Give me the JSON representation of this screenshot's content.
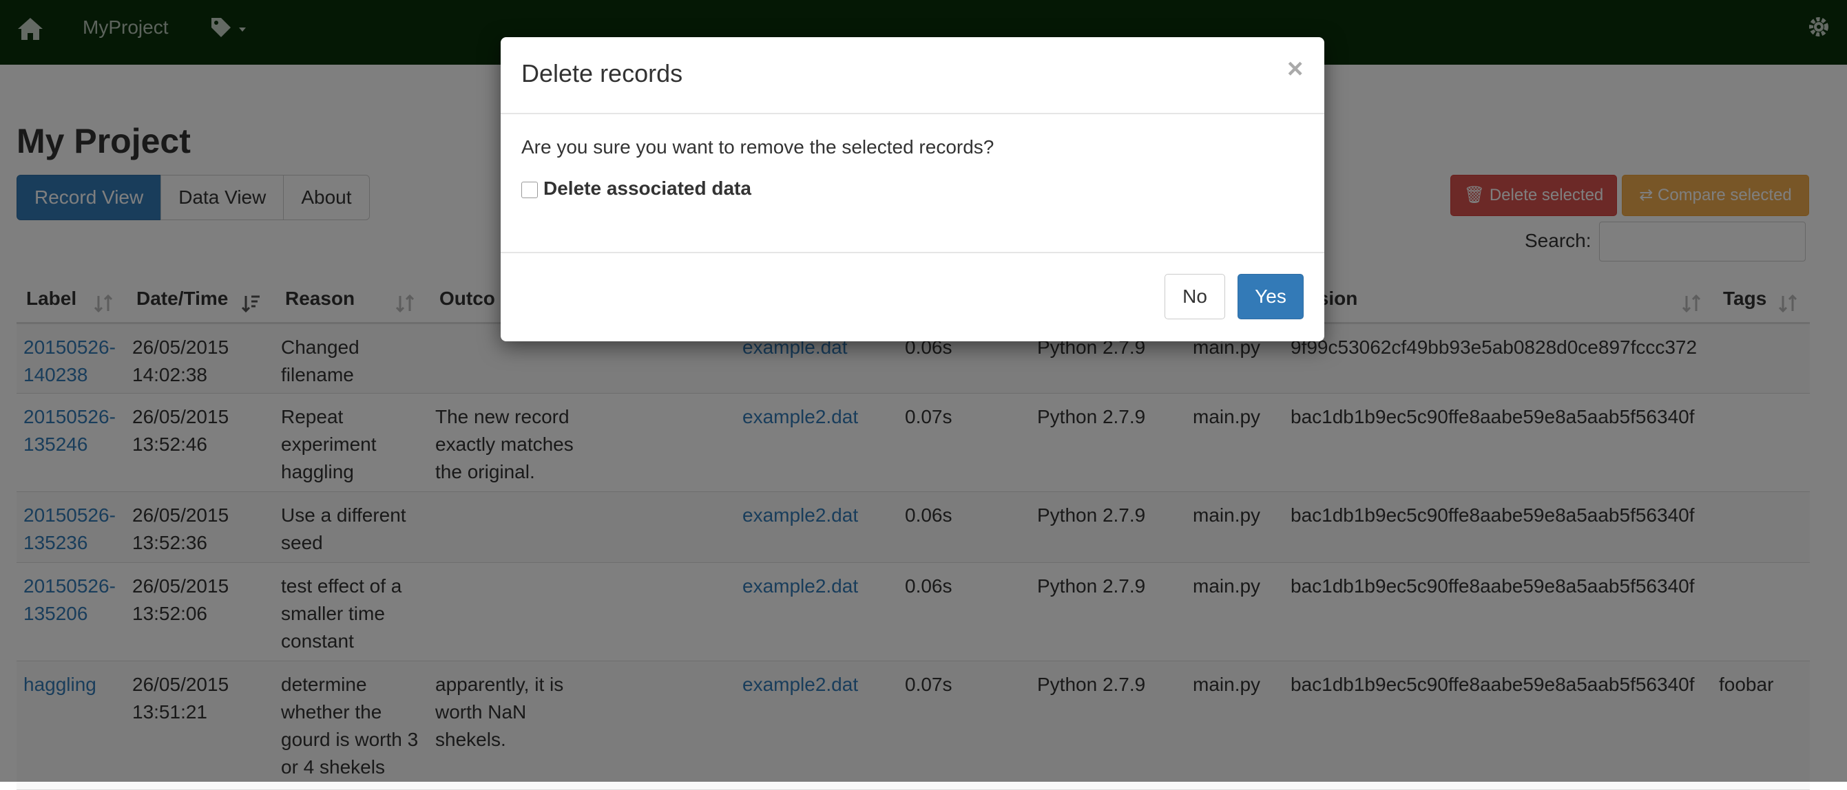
{
  "navbar": {
    "brand": "MyProject",
    "icons": [
      "home-icon",
      "tag-icon",
      "chevron-down-icon",
      "gear-icon"
    ],
    "background": "#0a300a"
  },
  "page": {
    "title": "My Project",
    "tabs": [
      {
        "label": "Record View",
        "active": true
      },
      {
        "label": "Data View",
        "active": false
      },
      {
        "label": "About",
        "active": false
      }
    ],
    "delete_selected": "Delete selected",
    "compare_selected": "Compare selected",
    "search_label": "Search:",
    "search_value": ""
  },
  "table": {
    "headers": [
      "Label",
      "Date/Time",
      "Reason",
      "Outcome",
      "Version",
      "Tags"
    ],
    "visible_header_fragments": {
      "outcome": "Outco",
      "version": "ision"
    },
    "rows": [
      {
        "label": [
          "20150526-",
          "140238"
        ],
        "datetime": [
          "26/05/2015",
          "14:02:38"
        ],
        "reason": [
          "Changed",
          "filename"
        ],
        "outcome": [],
        "data": "example.dat",
        "duration": "0.06s",
        "executable": "Python 2.7.9",
        "script": "main.py",
        "version": "9f99c53062cf49bb93e5ab0828d0ce897fccc372",
        "tags": ""
      },
      {
        "label": [
          "20150526-",
          "135246"
        ],
        "datetime": [
          "26/05/2015",
          "13:52:46"
        ],
        "reason": [
          "Repeat",
          "experiment",
          "haggling"
        ],
        "outcome": [
          "The new record",
          "exactly matches",
          "the original."
        ],
        "data": "example2.dat",
        "duration": "0.07s",
        "executable": "Python 2.7.9",
        "script": "main.py",
        "version": "bac1db1b9ec5c90ffe8aabe59e8a5aab5f56340f",
        "tags": ""
      },
      {
        "label": [
          "20150526-",
          "135236"
        ],
        "datetime": [
          "26/05/2015",
          "13:52:36"
        ],
        "reason": [
          "Use a different",
          "seed"
        ],
        "outcome": [],
        "data": "example2.dat",
        "duration": "0.06s",
        "executable": "Python 2.7.9",
        "script": "main.py",
        "version": "bac1db1b9ec5c90ffe8aabe59e8a5aab5f56340f",
        "tags": ""
      },
      {
        "label": [
          "20150526-",
          "135206"
        ],
        "datetime": [
          "26/05/2015",
          "13:52:06"
        ],
        "reason": [
          "test effect of a",
          "smaller time",
          "constant"
        ],
        "outcome": [],
        "data": "example2.dat",
        "duration": "0.06s",
        "executable": "Python 2.7.9",
        "script": "main.py",
        "version": "bac1db1b9ec5c90ffe8aabe59e8a5aab5f56340f",
        "tags": ""
      },
      {
        "label": [
          "haggling"
        ],
        "datetime": [
          "26/05/2015",
          "13:51:21"
        ],
        "reason": [
          "determine",
          "whether the",
          "gourd is worth 3",
          "or 4 shekels"
        ],
        "outcome": [
          "apparently, it is",
          "worth NaN",
          "shekels."
        ],
        "data": "example2.dat",
        "duration": "0.07s",
        "executable": "Python 2.7.9",
        "script": "main.py",
        "version": "bac1db1b9ec5c90ffe8aabe59e8a5aab5f56340f",
        "tags": "foobar"
      }
    ]
  },
  "modal": {
    "title": "Delete records",
    "close": "×",
    "question": "Are you sure you want to remove the selected records?",
    "checkbox_label": "Delete associated data",
    "checkbox_checked": false,
    "no_label": "No",
    "yes_label": "Yes"
  },
  "colors": {
    "primary": "#337ab7",
    "danger": "#d9534f",
    "warning": "#f0ad4e",
    "link": "#337ab7"
  }
}
